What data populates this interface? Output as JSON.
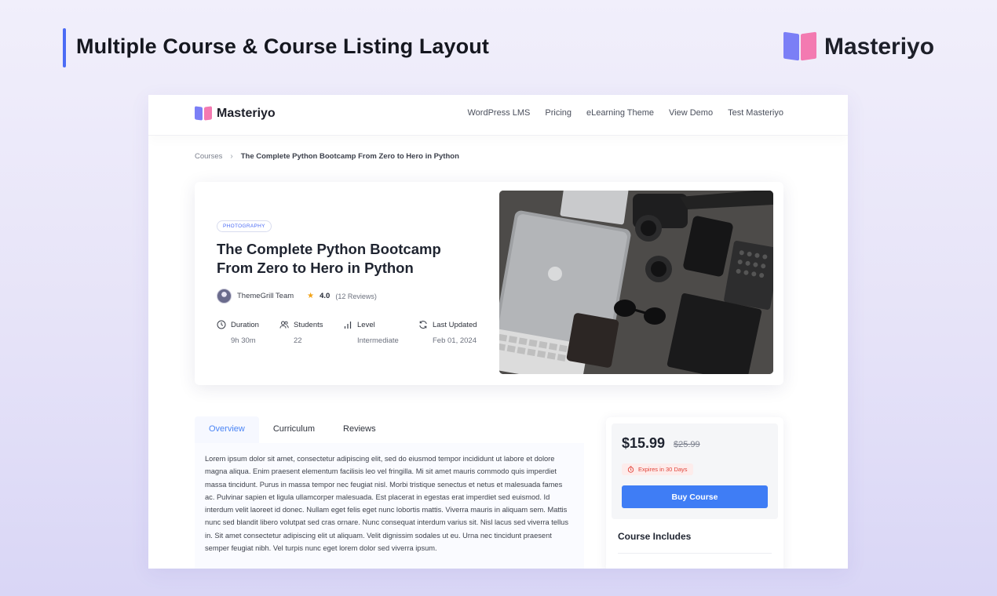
{
  "banner": {
    "title": "Multiple Course & Course Listing Layout",
    "brand": "Masteriyo"
  },
  "site": {
    "brand": "Masteriyo",
    "nav": [
      "WordPress LMS",
      "Pricing",
      "eLearning Theme",
      "View Demo",
      "Test Masteriyo"
    ]
  },
  "breadcrumb": {
    "root": "Courses",
    "current": "The Complete Python Bootcamp From Zero to Hero in Python"
  },
  "course": {
    "category": "PHOTOGRAPHY",
    "title": "The Complete Python Bootcamp From Zero to Hero in Python",
    "author": "ThemeGrill Team",
    "rating": "4.0",
    "reviews": "(12 Reviews)",
    "stats": [
      {
        "label": "Duration",
        "value": "9h 30m",
        "icon": "clock-icon"
      },
      {
        "label": "Students",
        "value": "22",
        "icon": "users-icon"
      },
      {
        "label": "Level",
        "value": "Intermediate",
        "icon": "bar-chart-icon"
      },
      {
        "label": "Last Updated",
        "value": "Feb 01, 2024",
        "icon": "refresh-icon"
      }
    ]
  },
  "tabs": [
    "Overview",
    "Curriculum",
    "Reviews"
  ],
  "overview": "Lorem ipsum dolor sit amet, consectetur adipiscing elit, sed do eiusmod tempor incididunt ut labore et dolore magna aliqua. Enim praesent elementum facilisis leo vel fringilla. Mi sit amet mauris commodo quis imperdiet massa tincidunt. Purus in massa tempor nec feugiat nisl. Morbi tristique senectus et netus et malesuada fames ac. Pulvinar sapien et ligula ullamcorper malesuada. Est placerat in egestas erat imperdiet sed euismod. Id interdum velit laoreet id donec. Nullam eget felis eget nunc lobortis mattis. Viverra mauris in aliquam sem. Mattis nunc sed blandit libero volutpat sed cras ornare. Nunc consequat interdum varius sit. Nisl lacus sed viverra tellus in. Sit amet consectetur adipiscing elit ut aliquam. Velit dignissim sodales ut eu. Urna nec tincidunt praesent semper feugiat nibh. Vel turpis nunc eget lorem dolor sed viverra ipsum.",
  "pricing": {
    "price": "$15.99",
    "old_price": "$25.99",
    "expiry": "Expires in 30 Days",
    "buy_label": "Buy Course",
    "includes_title": "Course Includes"
  },
  "colors": {
    "accent": "#4b6bf5",
    "button": "#3f7df5",
    "expiry": "#e2443a",
    "star": "#f2a216"
  }
}
